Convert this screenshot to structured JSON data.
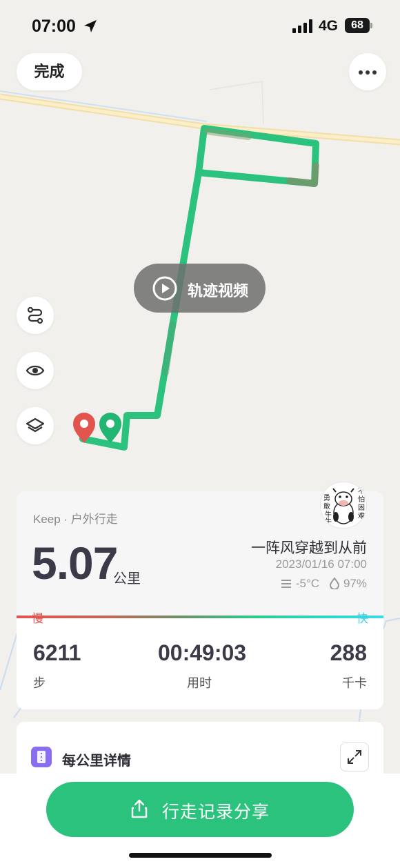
{
  "status_bar": {
    "time": "07:00",
    "network": "4G",
    "battery": "68"
  },
  "map": {
    "done_label": "完成",
    "video_label": "轨迹视频",
    "track_color": "#2bc27d",
    "start_pin_color": "#e2554f",
    "end_pin_color": "#22b573"
  },
  "summary": {
    "source": "Keep · 户外行走",
    "distance": "5.07",
    "distance_unit": "公里",
    "username": "一阵风穿越到从前",
    "date": "2023/01/16 07:00",
    "temperature": "-5°C",
    "humidity": "97%",
    "pace_slow": "慢",
    "pace_fast": "快",
    "steps_value": "6211",
    "steps_label": "步",
    "duration_value": "00:49:03",
    "duration_label": "用时",
    "calories_value": "288",
    "calories_label": "千卡",
    "avatar_text": [
      "勇",
      "敢",
      "牛",
      "牛",
      "不",
      "怕",
      "困",
      "难"
    ]
  },
  "km_details": {
    "title": "每公里详情"
  },
  "share": {
    "label": "行走记录分享",
    "color": "#2bc27d"
  }
}
